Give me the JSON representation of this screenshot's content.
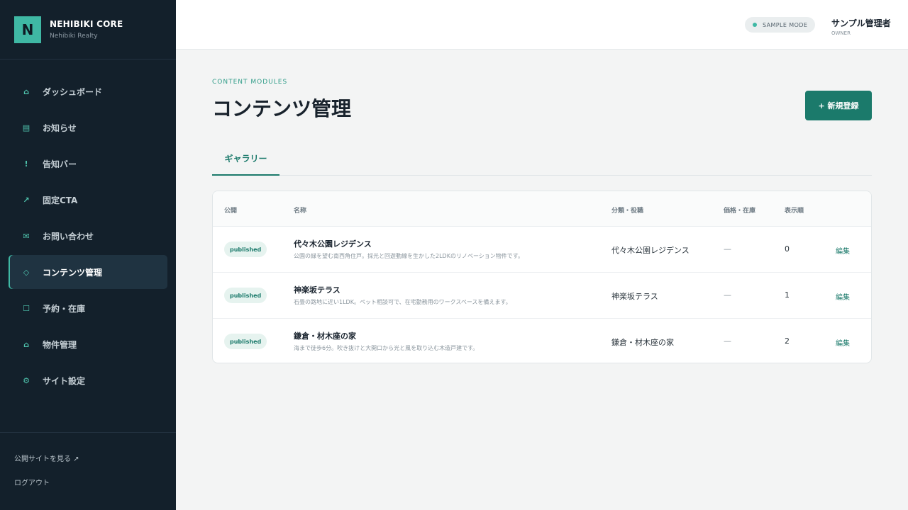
{
  "brand": {
    "logo_letter": "N",
    "name": "NEHIBIKI CORE",
    "sub": "Nehibiki Realty"
  },
  "nav": [
    {
      "icon": "home-icon",
      "glyph": "⌂",
      "label": "ダッシュボード",
      "active": false
    },
    {
      "icon": "news-icon",
      "glyph": "▤",
      "label": "お知らせ",
      "active": false
    },
    {
      "icon": "alert-icon",
      "glyph": "!",
      "label": "告知バー",
      "active": false
    },
    {
      "icon": "arrow-icon",
      "glyph": "↗",
      "label": "固定CTA",
      "active": false
    },
    {
      "icon": "mail-icon",
      "glyph": "✉",
      "label": "お問い合わせ",
      "active": false
    },
    {
      "icon": "diamond-icon",
      "glyph": "◇",
      "label": "コンテンツ管理",
      "active": true
    },
    {
      "icon": "square-icon",
      "glyph": "☐",
      "label": "予約・在庫",
      "active": false
    },
    {
      "icon": "home-icon",
      "glyph": "⌂",
      "label": "物件管理",
      "active": false
    },
    {
      "icon": "gear-icon",
      "glyph": "⚙",
      "label": "サイト設定",
      "active": false
    }
  ],
  "footer": {
    "view_site": "公開サイトを見る ↗",
    "logout": "ログアウト"
  },
  "header": {
    "mode": "SAMPLE MODE",
    "user_name": "サンプル管理者",
    "user_role": "OWNER"
  },
  "main": {
    "eyebrow": "CONTENT MODULES",
    "title": "コンテンツ管理",
    "new_button": "+ 新規登録",
    "tab": "ギャラリー"
  },
  "table": {
    "headers": {
      "status": "公開",
      "name": "名称",
      "category": "分類・役職",
      "price": "価格・在庫",
      "order": "表示順"
    },
    "rows": [
      {
        "status": "published",
        "name": "代々木公園レジデンス",
        "desc": "公園の緑を望む南西角住戸。採光と回遊動線を生かした2LDKのリノベーション物件です。",
        "category": "代々木公園レジデンス",
        "price": "—",
        "order": "0",
        "edit": "編集"
      },
      {
        "status": "published",
        "name": "神楽坂テラス",
        "desc": "石畳の路地に近い1LDK。ペット相談可で、在宅勤務用のワークスペースを備えます。",
        "category": "神楽坂テラス",
        "price": "—",
        "order": "1",
        "edit": "編集"
      },
      {
        "status": "published",
        "name": "鎌倉・材木座の家",
        "desc": "海まで徒歩6分。吹き抜けと大開口から光と風を取り込む木造戸建です。",
        "category": "鎌倉・材木座の家",
        "price": "—",
        "order": "2",
        "edit": "編集"
      }
    ]
  }
}
